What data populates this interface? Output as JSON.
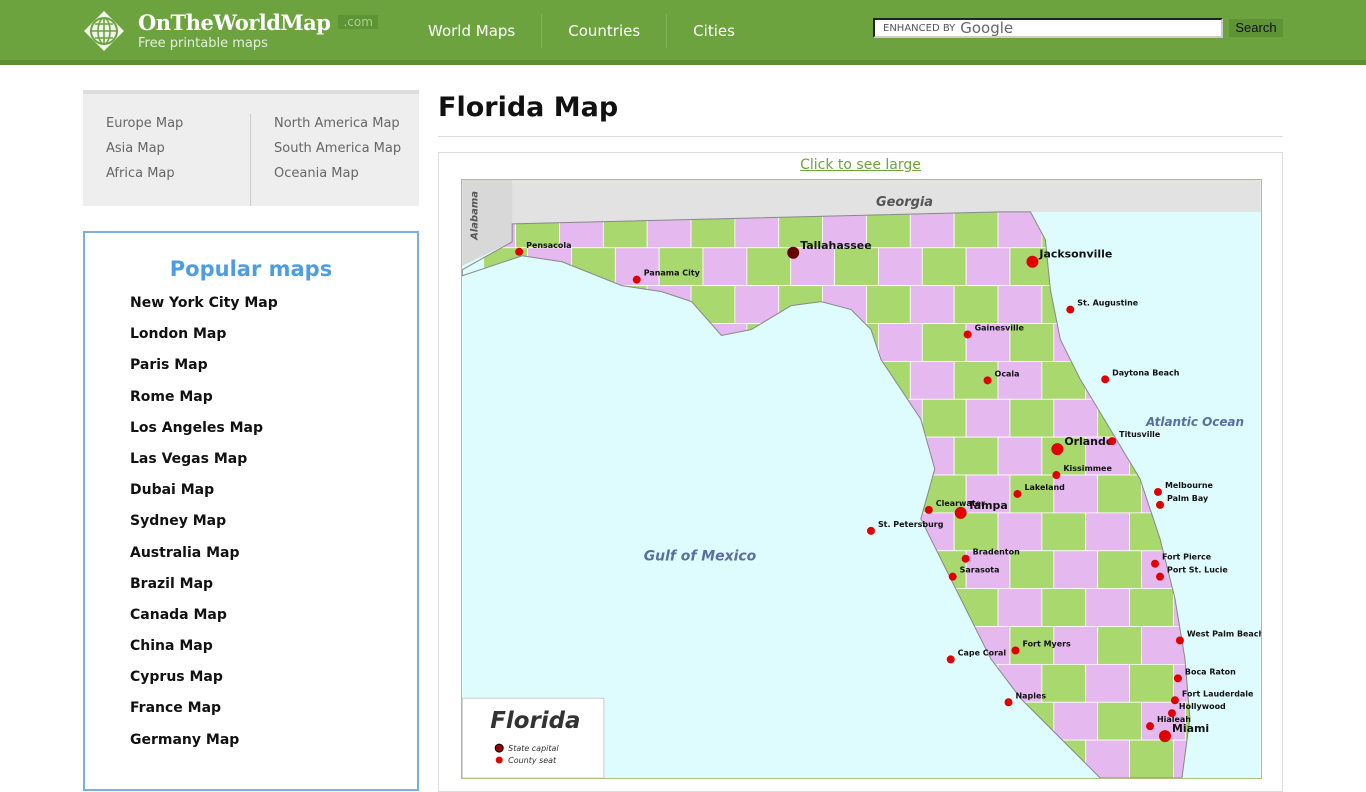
{
  "header": {
    "brand": "OnTheWorldMap",
    "tld": ".com",
    "tagline": "Free printable maps",
    "nav": [
      "World Maps",
      "Countries",
      "Cities"
    ],
    "search_placeholder": "ENHANCED BY",
    "search_brand": "Google",
    "search_button": "Search"
  },
  "regions": {
    "left": [
      "Europe Map",
      "Asia Map",
      "Africa Map"
    ],
    "right": [
      "North America Map",
      "South America Map",
      "Oceania Map"
    ]
  },
  "popular": {
    "title": "Popular maps",
    "items": [
      "New York City Map",
      "London Map",
      "Paris Map",
      "Rome Map",
      "Los Angeles Map",
      "Las Vegas Map",
      "Dubai Map",
      "Sydney Map",
      "Australia Map",
      "Brazil Map",
      "Canada Map",
      "China Map",
      "Cyprus Map",
      "France Map",
      "Germany Map"
    ]
  },
  "main": {
    "title": "Florida Map",
    "link": "Click to see large"
  },
  "map": {
    "labels": {
      "georgia": "Georgia",
      "alabama": "Alabama",
      "gulf": "Gulf of Mexico",
      "atlantic": "Atlantic Ocean"
    },
    "legend": {
      "title": "Florida",
      "capital": "State capital",
      "seat": "County seat"
    },
    "cities": [
      "Tallahassee",
      "Jacksonville",
      "Pensacola",
      "Panama City",
      "Gainesville",
      "Ocala",
      "Orlando",
      "Tampa",
      "St. Petersburg",
      "Clearwater",
      "Sarasota",
      "Fort Myers",
      "Cape Coral",
      "Naples",
      "West Palm Beach",
      "Fort Lauderdale",
      "Hialeah",
      "Miami",
      "Daytona Beach",
      "St. Augustine",
      "Lakeland",
      "Kissimmee",
      "Fort Pierce",
      "Melbourne",
      "Titusville",
      "Bradenton",
      "Port St. Lucie",
      "Hollywood",
      "Boca Raton",
      "Palm Bay"
    ],
    "colors": {
      "sea": "#defbfd",
      "georgia": "#e2e2e2",
      "dot": "#e00000"
    }
  }
}
